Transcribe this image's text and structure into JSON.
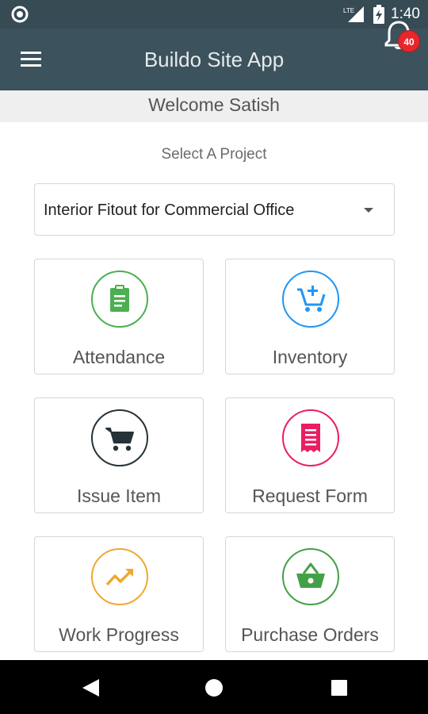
{
  "status_bar": {
    "time": "1:40",
    "network_label": "LTE",
    "left_icon": "circle-notification-icon",
    "signal_icon": "signal-icon",
    "battery_icon": "battery-charging-icon"
  },
  "app_bar": {
    "title": "Buildo Site App",
    "menu_icon": "hamburger-menu-icon",
    "notification_icon": "bell-icon",
    "notification_count": "40"
  },
  "welcome": {
    "text": "Welcome Satish"
  },
  "project_select": {
    "label": "Select A Project",
    "selected_value": "Interior Fitout for Commercial Office"
  },
  "tiles": [
    {
      "label": "Attendance",
      "icon": "clipboard-icon",
      "color": "#4caf50"
    },
    {
      "label": "Inventory",
      "icon": "add-to-cart-icon",
      "color": "#2196f3"
    },
    {
      "label": "Issue Item",
      "icon": "shopping-cart-icon",
      "color": "#263238"
    },
    {
      "label": "Request Form",
      "icon": "receipt-icon",
      "color": "#e91e63"
    },
    {
      "label": "Work Progress",
      "icon": "trending-up-icon",
      "color": "#f0a830"
    },
    {
      "label": "Purchase Orders",
      "icon": "basket-icon",
      "color": "#43a047"
    }
  ],
  "nav_bar": {
    "back_icon": "back-triangle-icon",
    "home_icon": "home-circle-icon",
    "recent_icon": "recent-apps-square-icon"
  },
  "colors": {
    "app_bar": "#3c525c",
    "status_bar": "#364b54",
    "badge": "#e8262b"
  }
}
